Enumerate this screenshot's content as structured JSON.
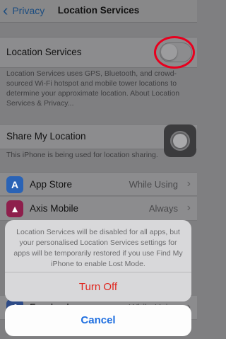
{
  "nav": {
    "back_label": "Privacy",
    "back_icon": "chevron-left-icon",
    "title": "Location Services"
  },
  "location_services": {
    "label": "Location Services",
    "toggle_on": false,
    "footer": "Location Services uses GPS, Bluetooth, and crowd-sourced Wi-Fi hotspot and mobile tower locations to determine your approximate location. About Location Services & Privacy..."
  },
  "share_location": {
    "label": "Share My Location",
    "footer": "This iPhone is being used for location sharing."
  },
  "apps": [
    {
      "name": "App Store",
      "value": "While Using",
      "icon": "app-store-icon",
      "color": "#2a63b6"
    },
    {
      "name": "Axis Mobile",
      "value": "Always",
      "icon": "axis-bank-icon",
      "color": "#8e1f4c"
    },
    {
      "name": "Facebook",
      "value": "While Using",
      "icon": "facebook-icon",
      "color": "#2d4a86"
    }
  ],
  "action_sheet": {
    "message": "Location Services will be disabled for all apps, but your personalised Location Services settings for apps will be temporarily restored if you use Find My iPhone to enable Lost Mode.",
    "turn_off_label": "Turn Off",
    "cancel_label": "Cancel"
  },
  "colors": {
    "annotation_circle": "#e8001e",
    "destructive": "#e0241c",
    "cancel": "#1f6fe0"
  }
}
